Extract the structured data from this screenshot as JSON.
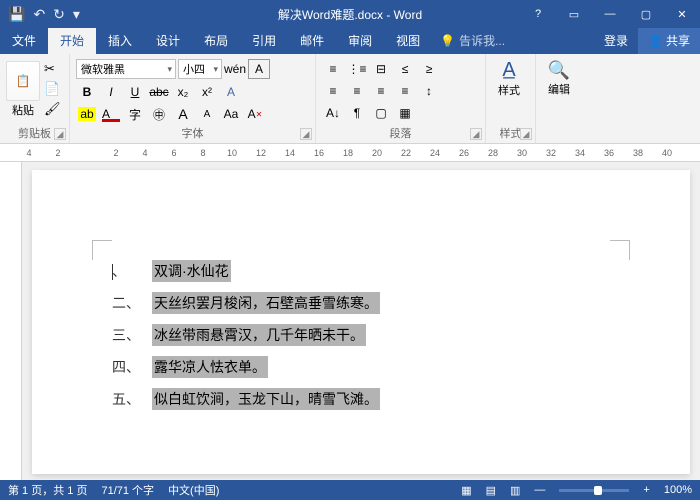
{
  "app": {
    "title": "解决Word难题.docx - Word"
  },
  "qat": {
    "save": "💾",
    "undo": "↶",
    "redo": "↻",
    "more": "▾"
  },
  "window": {
    "help": "?",
    "opts": "▭",
    "min": "—",
    "max": "▢",
    "close": "✕"
  },
  "tabs": {
    "file": "文件",
    "home": "开始",
    "insert": "插入",
    "design": "设计",
    "layout": "布局",
    "references": "引用",
    "mailings": "邮件",
    "review": "审阅",
    "view": "视图",
    "tellme": "告诉我...",
    "login": "登录",
    "share": "共享"
  },
  "ribbon": {
    "clipboard": {
      "label": "剪贴板",
      "paste": "粘贴",
      "cut": "✂",
      "copy": "📄",
      "fmtpainter": "🖌"
    },
    "font": {
      "label": "字体",
      "name": "微软雅黑",
      "size": "小四",
      "pinyin": "wén",
      "charborder": "A",
      "bold": "B",
      "italic": "I",
      "underline": "U",
      "strike": "abc",
      "sub": "x₂",
      "sup": "x²",
      "effects": "Aa",
      "clear": "✕",
      "highlight": "ab",
      "fontcolor": "A",
      "enclose": "字",
      "grow": "A",
      "shrink": "A"
    },
    "paragraph": {
      "label": "段落",
      "bullets": "≡",
      "numbering": "⋮≡",
      "multilevel": "⊟",
      "decrease": "≤",
      "increase": "≥",
      "sort": "A↓",
      "marks": "¶",
      "left": "≡",
      "center": "≡",
      "right": "≡",
      "justify": "≡",
      "spacing": "↕",
      "shading": "▢",
      "borders": "▦"
    },
    "styles": {
      "label": "样式",
      "styles": "样式"
    },
    "editing": {
      "label": "编辑",
      "edit": "编辑",
      "find": "🔍"
    }
  },
  "ruler": [
    "4",
    "2",
    "",
    "2",
    "4",
    "6",
    "8",
    "10",
    "12",
    "14",
    "16",
    "18",
    "20",
    "22",
    "24",
    "26",
    "28",
    "30",
    "32",
    "34",
    "36",
    "38",
    "40"
  ],
  "doc": {
    "lines": [
      {
        "num": "",
        "text": "双调·水仙花",
        "caret": true
      },
      {
        "num": "二、",
        "text": "天丝织罢月梭闲，石壁高垂雪练寒。"
      },
      {
        "num": "三、",
        "text": "冰丝带雨悬霄汉，几千年晒未干。"
      },
      {
        "num": "四、",
        "text": "露华凉人怯衣单。"
      },
      {
        "num": "五、",
        "text": "似白虹饮涧，玉龙下山，晴雪飞滩。"
      }
    ]
  },
  "status": {
    "page": "第 1 页，共 1 页",
    "words": "71/71 个字",
    "lang": "中文(中国)",
    "zoom": "100%",
    "plus": "+",
    "minus": "—"
  }
}
